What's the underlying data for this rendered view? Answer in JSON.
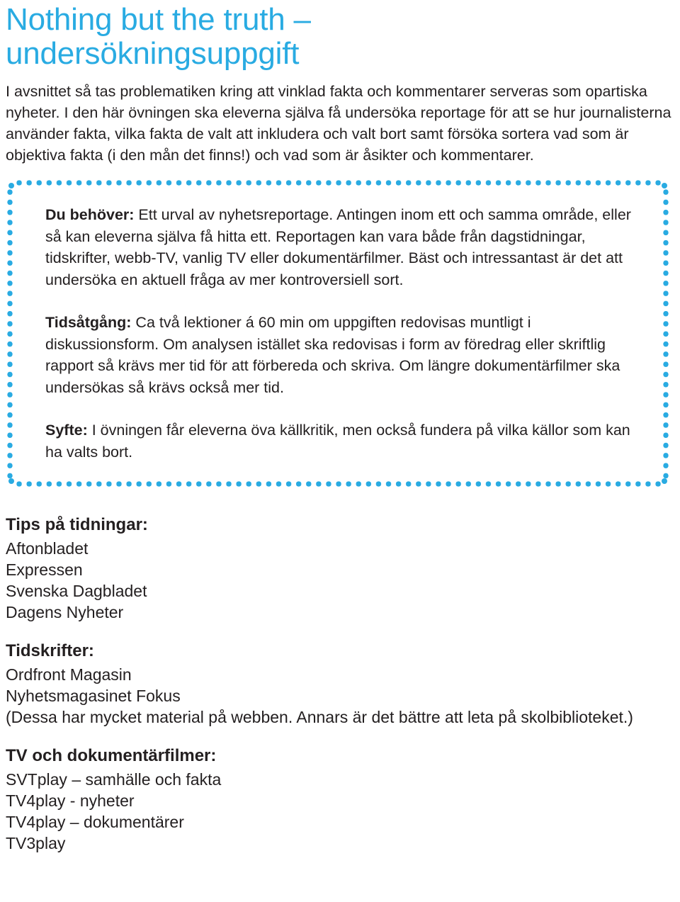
{
  "colors": {
    "accent_blue": "#29abe2",
    "body_text": "#231f20",
    "background": "#ffffff"
  },
  "title": "Nothing but the truth –\nundersökningsuppgift",
  "intro": "I avsnittet så tas problematiken kring att vinklad fakta och kommentarer serveras som opartiska nyheter. I den här övningen ska eleverna själva få undersöka reportage för att se hur journalisterna använder fakta, vilka fakta de valt att inkludera och valt bort samt försöka sortera vad som är objektiva fakta (i den mån det finns!) och vad som är åsikter och kommentarer.",
  "info_box": {
    "paragraphs": [
      {
        "label": "Du behöver:",
        "text": " Ett urval av nyhetsreportage. Antingen inom ett och samma område, eller så kan eleverna själva få hitta ett. Reportagen kan vara både från dagstidningar, tidskrifter, webb-TV, vanlig TV eller dokumentärfilmer. Bäst och intressantast är det att undersöka en aktuell fråga av mer kontroversiell sort."
      },
      {
        "label": "Tidsåtgång:",
        "text": " Ca två lektioner á 60 min om uppgiften redovisas muntligt i diskussionsform. Om analysen istället ska redovisas i form av föredrag eller skriftlig rapport så krävs mer tid för att förbereda och skriva. Om längre dokumentärfilmer ska undersökas så krävs också mer tid."
      },
      {
        "label": "Syfte:",
        "text": " I övningen får eleverna öva källkritik, men också fundera på vilka källor som kan ha valts bort."
      }
    ]
  },
  "resource_lists": [
    {
      "heading": "Tips på tidningar:",
      "items": [
        "Aftonbladet",
        "Expressen",
        "Svenska Dagbladet",
        "Dagens Nyheter"
      ]
    },
    {
      "heading": "Tidskrifter:",
      "items": [
        "Ordfront Magasin",
        "Nyhetsmagasinet Fokus",
        "(Dessa har mycket material på webben. Annars är det bättre att leta på skolbiblioteket.)"
      ]
    },
    {
      "heading": "TV och dokumentärfilmer:",
      "items": [
        "SVTplay – samhälle och fakta",
        "TV4play - nyheter",
        "TV4play – dokumentärer",
        "TV3play"
      ]
    }
  ]
}
